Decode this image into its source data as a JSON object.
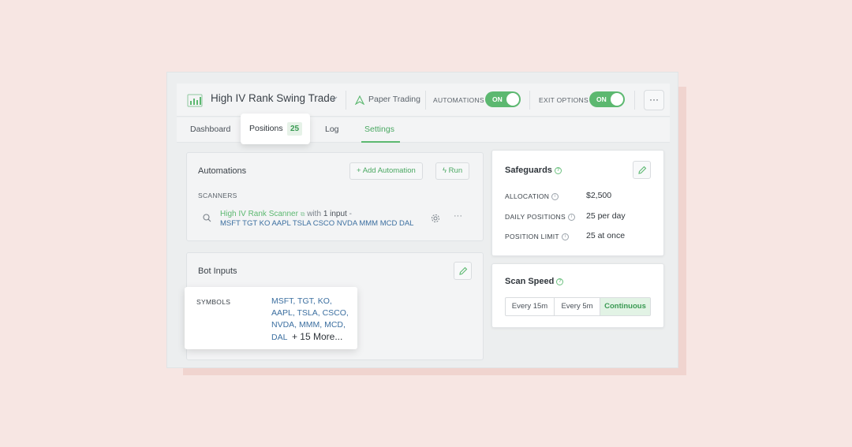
{
  "header": {
    "bot_title": "High IV Rank Swing Trade",
    "paper_trading": "Paper Trading",
    "automations_label": "AUTOMATIONS",
    "automations_toggle": "ON",
    "exit_options_label": "EXIT OPTIONS",
    "exit_options_toggle": "ON",
    "more": "···"
  },
  "tabs": {
    "dashboard": "Dashboard",
    "positions": "Positions",
    "positions_count": "25",
    "log": "Log",
    "settings": "Settings"
  },
  "automations": {
    "title": "Automations",
    "add_button": "Add Automation",
    "run_button": "Run",
    "scanners_label": "SCANNERS",
    "scanner_name": "High IV Rank Scanner",
    "scanner_with": "with",
    "scanner_inputs": "1 input",
    "scanner_dash": "-",
    "scanner_symbols": "MSFT TGT KO AAPL TSLA CSCO NVDA MMM MCD DAL",
    "more": "···"
  },
  "bot_inputs": {
    "title": "Bot Inputs",
    "symbols_label": "SYMBOLS",
    "symbols_line1": "MSFT, TGT, KO,",
    "symbols_line2": "AAPL, TSLA, CSCO,",
    "symbols_line3": "NVDA, MMM, MCD,",
    "symbols_line4": "DAL",
    "more_count": "+ 15 More..."
  },
  "safeguards": {
    "title": "Safeguards",
    "allocation_label": "ALLOCATION",
    "allocation_value": "$2,500",
    "daily_label": "DAILY POSITIONS",
    "daily_value": "25 per day",
    "limit_label": "POSITION LIMIT",
    "limit_value": "25 at once"
  },
  "scan_speed": {
    "title": "Scan Speed",
    "options": [
      "Every 15m",
      "Every 5m",
      "Continuous"
    ],
    "selected": "Continuous"
  },
  "colors": {
    "accent_green": "#5cb870",
    "link_blue": "#3c6fa0",
    "background": "#f7e6e3"
  }
}
